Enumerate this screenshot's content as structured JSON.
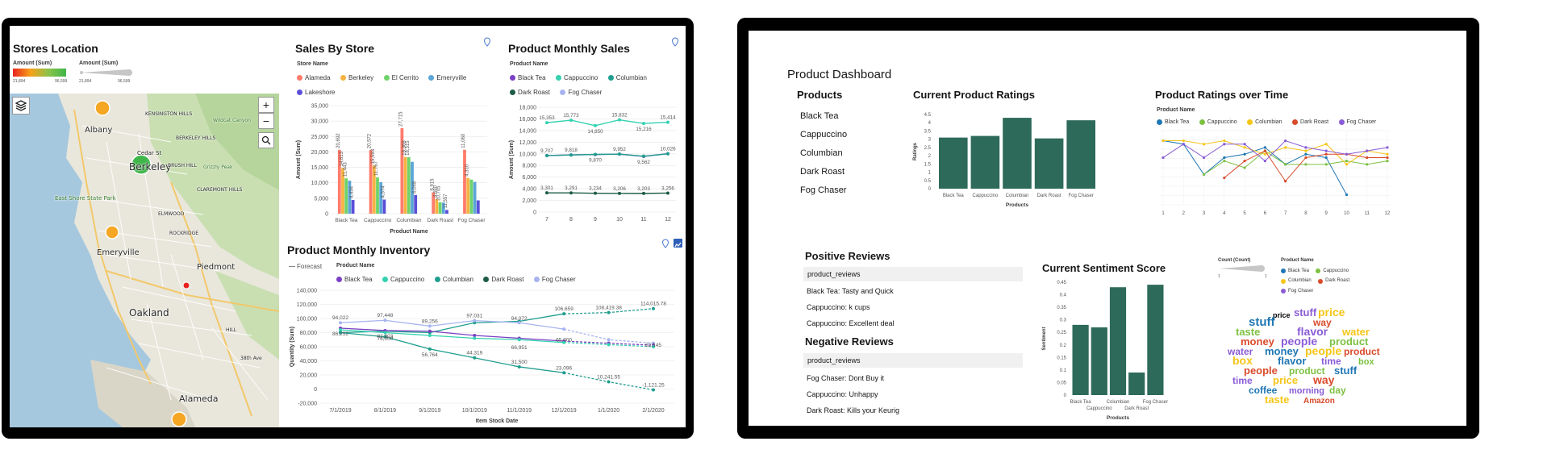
{
  "left": {
    "stores_location": {
      "title": "Stores Location",
      "legend_amount_color": "Amount (Sum)",
      "legend_amount_size": "Amount (Sum)",
      "range_min": "21,894",
      "range_max": "96,599",
      "size_min": "21,894",
      "size_max": "96,599",
      "zoom_in": "+",
      "zoom_out": "−",
      "map_labels": [
        "Albany",
        "Berkeley",
        "East Shore State Park",
        "Emeryville",
        "Piedmont",
        "Oakland",
        "Alameda",
        "ELMWOOD",
        "ROCKRIDGE",
        "CLAREMONT HILLS",
        "BERKELEY HILLS",
        "KENSINGTON HILLS",
        "Cedar St",
        "BRUSH HILL",
        "Grizzly Peak",
        "Wildcat Canyon",
        "HILL",
        "38th Ave"
      ]
    },
    "sales_by_store": {
      "title": "Sales By Store",
      "legend_title": "Store Name",
      "legend": [
        {
          "name": "Alameda",
          "color": "#ff7b6b"
        },
        {
          "name": "Berkeley",
          "color": "#f5b342"
        },
        {
          "name": "El Cerrito",
          "color": "#6fd36a"
        },
        {
          "name": "Emeryville",
          "color": "#5ba6d6"
        },
        {
          "name": "Lakeshore",
          "color": "#5b4fd8"
        }
      ]
    },
    "product_monthly_sales": {
      "title": "Product Monthly Sales",
      "legend_title": "Product Name",
      "legend": [
        {
          "name": "Black Tea",
          "color": "#7b3fc4"
        },
        {
          "name": "Cappuccino",
          "color": "#34d2b0"
        },
        {
          "name": "Columbian",
          "color": "#1f9e8e"
        },
        {
          "name": "Dark Roast",
          "color": "#1d5c47"
        },
        {
          "name": "Fog Chaser",
          "color": "#a7b4f0"
        }
      ]
    },
    "product_monthly_inventory": {
      "title": "Product Monthly Inventory",
      "forecast_label": "Forecast",
      "legend_title": "Product Name",
      "legend": [
        {
          "name": "Black Tea",
          "color": "#7b3fc4"
        },
        {
          "name": "Cappuccino",
          "color": "#34d2b0"
        },
        {
          "name": "Columbian",
          "color": "#1f9e8e"
        },
        {
          "name": "Dark Roast",
          "color": "#1d5c47"
        },
        {
          "name": "Fog Chaser",
          "color": "#a7b4f0"
        }
      ]
    }
  },
  "right": {
    "dashboard_title": "Product Dashboard",
    "products": {
      "title": "Products",
      "items": [
        "Black Tea",
        "Cappuccino",
        "Columbian",
        "Dark Roast",
        "Fog Chaser"
      ]
    },
    "current_product_ratings": {
      "title": "Current Product Ratings"
    },
    "product_ratings_over_time": {
      "title": "Product Ratings over Time",
      "legend_title": "Product Name",
      "legend": [
        {
          "name": "Black Tea",
          "color": "#1f77b4"
        },
        {
          "name": "Cappuccino",
          "color": "#7dc142"
        },
        {
          "name": "Columbian",
          "color": "#f5c518"
        },
        {
          "name": "Dark Roast",
          "color": "#d94b2b"
        },
        {
          "name": "Fog Chaser",
          "color": "#8a5cd6"
        }
      ]
    },
    "positive_reviews": {
      "title": "Positive Reviews",
      "header": "product_reviews",
      "items": [
        "Black Tea: Tasty and Quick",
        "Cappuccino: k cups",
        "Cappuccino: Excellent deal"
      ]
    },
    "negative_reviews": {
      "title": "Negative Reviews",
      "header": "product_reviews",
      "items": [
        "Fog Chaser: Dont Buy it",
        "Cappuccino: Unhappy",
        "Dark Roast: Kills your Keurig"
      ]
    },
    "current_sentiment_score": {
      "title": "Current Sentiment Score"
    },
    "word_cloud": {
      "count_label": "Count (Count)",
      "count_min": "1",
      "count_max": "1",
      "legend_title": "Product Name",
      "legend": [
        {
          "name": "Black Tea",
          "color": "#1f77b4"
        },
        {
          "name": "Cappuccino",
          "color": "#7dc142"
        },
        {
          "name": "Columbian",
          "color": "#f5c518"
        },
        {
          "name": "Dark Roast",
          "color": "#d94b2b"
        },
        {
          "name": "Fog Chaser",
          "color": "#8a5cd6"
        }
      ],
      "words": [
        "price",
        "stuff",
        "way",
        "taste",
        "flavor",
        "water",
        "money",
        "people",
        "product",
        "box",
        "time",
        "coffee",
        "morning",
        "day",
        "Amazon"
      ]
    }
  },
  "chart_data": [
    {
      "type": "bar",
      "title": "Sales By Store",
      "xlabel": "Product Name",
      "ylabel": "Amount (Sum)",
      "categories": [
        "Black Tea",
        "Cappuccino",
        "Columbian",
        "Dark Roast",
        "Fog Chaser"
      ],
      "ylim": [
        0,
        35000
      ],
      "yticks": [
        "0",
        "5,000",
        "10,000",
        "15,000",
        "20,000",
        "25,000",
        "30,000",
        "35,000"
      ],
      "series": [
        {
          "name": "Alameda",
          "values": [
            20692,
            20572,
            27715,
            6915,
            20705
          ]
        },
        {
          "name": "Berkeley",
          "values": [
            14813,
            15593,
            18368,
            4690,
            11557
          ]
        },
        {
          "name": "El Cerrito",
          "values": [
            11443,
            11767,
            18315,
            3700,
            11060
          ]
        },
        {
          "name": "Emeryville",
          "values": [
            10700,
            10200,
            16800,
            3600,
            10300
          ]
        },
        {
          "name": "Lakeshore",
          "values": [
            4434,
            4574,
            6048,
            1200,
            4310
          ]
        }
      ],
      "data_labels": [
        "20,692",
        "14,813",
        "11,443",
        "4,434",
        "20,572",
        "15,593",
        "11,767",
        "4,574",
        "27,715",
        "18,368",
        "18,315",
        "6,048",
        "6,915",
        "4,690",
        "20,705",
        "11,557",
        "11,060",
        "4,310"
      ]
    },
    {
      "type": "line",
      "title": "Product Monthly Sales",
      "xlabel": "",
      "ylabel": "Amount (Sum)",
      "x": [
        7,
        8,
        9,
        10,
        11,
        12
      ],
      "ylim": [
        0,
        18000
      ],
      "yticks": [
        "0",
        "2,000",
        "4,000",
        "6,000",
        "8,000",
        "10,000",
        "12,000",
        "14,000",
        "16,000",
        "18,000"
      ],
      "series": [
        {
          "name": "Columbian",
          "values": [
            15353,
            15773,
            14850,
            15832,
            15216,
            15414
          ]
        },
        {
          "name": "Black Tea",
          "values": [
            9707,
            9818,
            9870,
            9952,
            9562,
            10026
          ]
        },
        {
          "name": "Cappuccino",
          "values": [
            9700,
            9800,
            9900,
            9950,
            9600,
            10000
          ]
        },
        {
          "name": "Dark Roast",
          "values": [
            3301,
            3291,
            3234,
            3206,
            3203,
            3256
          ]
        }
      ],
      "data_labels": [
        "15,353",
        "15,773",
        "14,850",
        "15,832",
        "15,216",
        "15,414",
        "9,707",
        "9,818",
        "9,870",
        "9,952",
        "9,562",
        "10,026",
        "3,301",
        "3,291",
        "3,234",
        "3,206",
        "3,203",
        "3,256"
      ]
    },
    {
      "type": "line",
      "title": "Product Monthly Inventory",
      "xlabel": "Item Stock Date",
      "ylabel": "Quantity (Sum)",
      "categories": [
        "7/1/2019",
        "8/1/2019",
        "9/1/2019",
        "10/1/2019",
        "11/1/2019",
        "12/1/2019",
        "1/1/2020",
        "2/1/2020"
      ],
      "ylim": [
        -20000,
        140000
      ],
      "yticks": [
        "-20,000",
        "0",
        "20,000",
        "40,000",
        "60,000",
        "80,000",
        "100,000",
        "120,000",
        "140,000"
      ],
      "series": [
        {
          "name": "Dark Roast",
          "values": [
            80000,
            82000,
            80000,
            94000,
            96000,
            106659,
            108419,
            114015
          ]
        },
        {
          "name": "Fog Chaser",
          "values": [
            94022,
            97448,
            89256,
            97031,
            94000,
            85000,
            70000,
            65000
          ]
        },
        {
          "name": "Black Tea",
          "values": [
            86252,
            82903,
            82000,
            76000,
            72000,
            68000,
            65000,
            62145
          ]
        },
        {
          "name": "Cappuccino",
          "values": [
            84000,
            80000,
            76000,
            72000,
            70000,
            66000,
            63000,
            60000
          ]
        },
        {
          "name": "Columbian",
          "values": [
            80000,
            74000,
            56764,
            44319,
            31500,
            23096,
            10241,
            -1121
          ]
        }
      ],
      "data_labels": [
        "94,022",
        "86,252",
        "97,448",
        "82,903",
        "89,256",
        "97,031",
        "94,072",
        "76,000",
        "56,764",
        "44,319",
        "31,500",
        "23,096",
        "10,241.55",
        "-1,121.25",
        "106,659",
        "108,419.38",
        "114,015.78",
        "66,951",
        "65,000",
        "62,145"
      ]
    },
    {
      "type": "bar",
      "title": "Current Product Ratings",
      "xlabel": "Products",
      "ylabel": "Ratings",
      "categories": [
        "Black Tea",
        "Cappuccino",
        "Columbian",
        "Dark Roast",
        "Fog Chaser"
      ],
      "values": [
        3.1,
        3.2,
        4.3,
        3.05,
        4.15
      ],
      "ylim": [
        0,
        4.5
      ],
      "yticks": [
        "0",
        "0.5",
        "1",
        "1.5",
        "2",
        "2.5",
        "3",
        "3.5",
        "4",
        "4.5"
      ]
    },
    {
      "type": "line",
      "title": "Product Ratings over Time",
      "xlabel": "",
      "ylabel": "",
      "x": [
        1,
        2,
        3,
        4,
        5,
        6,
        7,
        8,
        9,
        10,
        11,
        12
      ],
      "series": [
        {
          "name": "Black Tea",
          "values": [
            4.2,
            4.1,
            3.2,
            3.7,
            3.8,
            4.0,
            3.5,
            3.8,
            3.7,
            2.6,
            null,
            null
          ]
        },
        {
          "name": "Cappuccino",
          "values": [
            null,
            null,
            3.2,
            3.6,
            3.4,
            3.9,
            3.5,
            3.5,
            3.5,
            3.6,
            3.5,
            3.6
          ]
        },
        {
          "name": "Columbian",
          "values": [
            4.2,
            4.2,
            4.1,
            4.2,
            4.0,
            3.8,
            4.0,
            3.9,
            4.1,
            3.5,
            3.9,
            3.8
          ]
        },
        {
          "name": "Dark Roast",
          "values": [
            null,
            null,
            null,
            3.1,
            3.6,
            3.9,
            3.0,
            3.7,
            3.8,
            3.8,
            3.7,
            3.7
          ]
        },
        {
          "name": "Fog Chaser",
          "values": [
            3.7,
            4.1,
            3.7,
            4.1,
            4.1,
            3.6,
            4.2,
            4.0,
            3.9,
            3.8,
            3.9,
            4.0
          ]
        }
      ]
    },
    {
      "type": "bar",
      "title": "Current Sentiment Score",
      "xlabel": "Products",
      "ylabel": "Sentiment",
      "categories": [
        "Black Tea",
        "Cappuccino",
        "Columbian",
        "Dark Roast",
        "Fog Chaser"
      ],
      "values": [
        0.28,
        0.27,
        0.43,
        0.09,
        0.44
      ],
      "ylim": [
        0,
        0.45
      ],
      "yticks": [
        "0",
        "0.05",
        "0.1",
        "0.15",
        "0.2",
        "0.25",
        "0.3",
        "0.35",
        "0.4",
        "0.45"
      ]
    }
  ]
}
